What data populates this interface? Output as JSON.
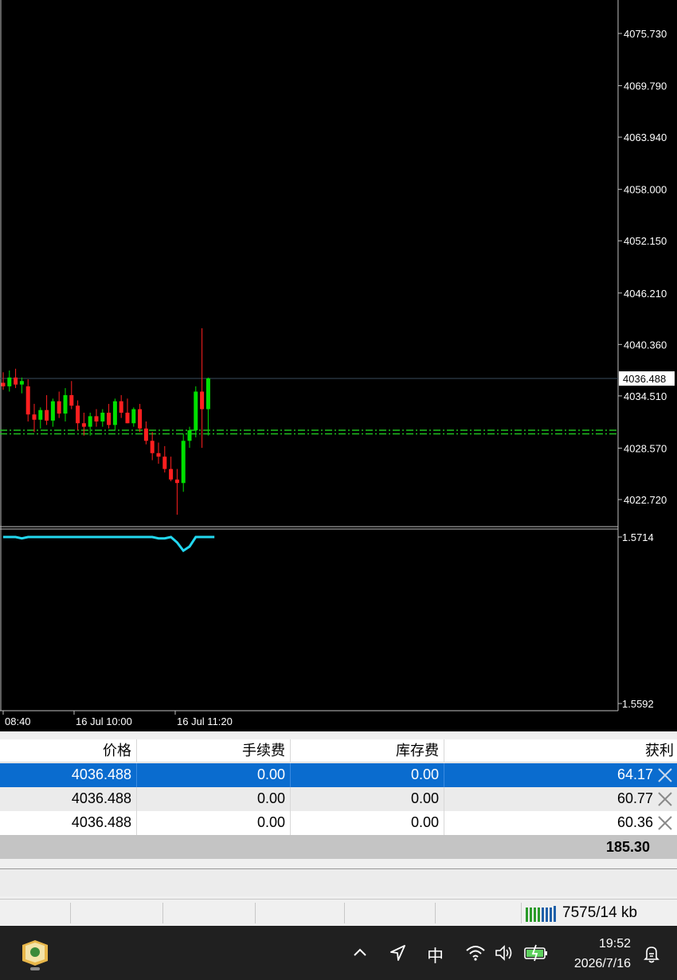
{
  "chart_data": {
    "type": "candlestick",
    "price_ticks": [
      "4075.730",
      "4069.790",
      "4063.940",
      "4058.000",
      "4052.150",
      "4046.210",
      "4040.360",
      "4034.510",
      "4028.570",
      "4022.720"
    ],
    "current_price": "4036.488",
    "indicator_ticks": [
      "1.5714",
      "1.5592"
    ],
    "time_labels": [
      "08:40",
      "16 Jul 10:00",
      "16 Jul 11:20"
    ],
    "candles": [
      {
        "o": 4036.0,
        "h": 4037.2,
        "l": 4035.2,
        "c": 4035.6
      },
      {
        "o": 4035.6,
        "h": 4037.4,
        "l": 4035.0,
        "c": 4036.6
      },
      {
        "o": 4036.6,
        "h": 4037.6,
        "l": 4035.4,
        "c": 4035.8
      },
      {
        "o": 4035.8,
        "h": 4036.6,
        "l": 4034.8,
        "c": 4036.2
      },
      {
        "o": 4035.6,
        "h": 4036.4,
        "l": 4031.6,
        "c": 4032.4
      },
      {
        "o": 4032.4,
        "h": 4033.6,
        "l": 4030.4,
        "c": 4031.8
      },
      {
        "o": 4031.8,
        "h": 4033.2,
        "l": 4030.8,
        "c": 4032.9
      },
      {
        "o": 4032.9,
        "h": 4034.6,
        "l": 4031.2,
        "c": 4031.7
      },
      {
        "o": 4031.7,
        "h": 4034.2,
        "l": 4031.0,
        "c": 4033.9
      },
      {
        "o": 4033.9,
        "h": 4035.0,
        "l": 4032.0,
        "c": 4032.5
      },
      {
        "o": 4032.5,
        "h": 4035.4,
        "l": 4031.6,
        "c": 4034.6
      },
      {
        "o": 4034.6,
        "h": 4036.2,
        "l": 4033.0,
        "c": 4033.4
      },
      {
        "o": 4033.4,
        "h": 4034.0,
        "l": 4030.6,
        "c": 4031.4
      },
      {
        "o": 4031.4,
        "h": 4032.6,
        "l": 4030.0,
        "c": 4031.0
      },
      {
        "o": 4031.0,
        "h": 4032.6,
        "l": 4030.0,
        "c": 4032.2
      },
      {
        "o": 4032.2,
        "h": 4033.0,
        "l": 4031.0,
        "c": 4031.6
      },
      {
        "o": 4031.6,
        "h": 4033.0,
        "l": 4031.0,
        "c": 4032.6
      },
      {
        "o": 4032.6,
        "h": 4033.6,
        "l": 4030.8,
        "c": 4031.2
      },
      {
        "o": 4031.2,
        "h": 4034.2,
        "l": 4030.6,
        "c": 4033.9
      },
      {
        "o": 4033.9,
        "h": 4034.6,
        "l": 4032.0,
        "c": 4032.6
      },
      {
        "o": 4032.6,
        "h": 4034.2,
        "l": 4031.4,
        "c": 4031.4
      },
      {
        "o": 4031.4,
        "h": 4033.2,
        "l": 4031.0,
        "c": 4033.0
      },
      {
        "o": 4033.0,
        "h": 4033.6,
        "l": 4030.4,
        "c": 4030.8
      },
      {
        "o": 4030.8,
        "h": 4031.6,
        "l": 4029.0,
        "c": 4029.4
      },
      {
        "o": 4029.4,
        "h": 4030.4,
        "l": 4027.2,
        "c": 4028.0
      },
      {
        "o": 4028.0,
        "h": 4029.2,
        "l": 4026.8,
        "c": 4027.6
      },
      {
        "o": 4027.6,
        "h": 4028.8,
        "l": 4025.8,
        "c": 4026.2
      },
      {
        "o": 4026.2,
        "h": 4027.6,
        "l": 4024.8,
        "c": 4025.0
      },
      {
        "o": 4025.0,
        "h": 4026.2,
        "l": 4021.0,
        "c": 4024.6
      },
      {
        "o": 4024.6,
        "h": 4030.2,
        "l": 4023.6,
        "c": 4029.4
      },
      {
        "o": 4029.4,
        "h": 4031.0,
        "l": 4028.6,
        "c": 4030.6
      },
      {
        "o": 4030.6,
        "h": 4035.6,
        "l": 4029.8,
        "c": 4035.0
      },
      {
        "o": 4035.0,
        "h": 4042.2,
        "l": 4028.6,
        "c": 4033.0
      },
      {
        "o": 4033.0,
        "h": 4036.6,
        "l": 4030.0,
        "c": 4036.5
      }
    ],
    "levels": [
      4030.6,
      4030.2
    ],
    "indicator_series": [
      1.5714,
      1.5714,
      1.5714,
      1.5713,
      1.5714,
      1.5714,
      1.5714,
      1.5714,
      1.5714,
      1.5714,
      1.5714,
      1.5714,
      1.5714,
      1.5714,
      1.5714,
      1.5714,
      1.5714,
      1.5714,
      1.5714,
      1.5714,
      1.5714,
      1.5714,
      1.5714,
      1.5714,
      1.5714,
      1.5713,
      1.5713,
      1.5714,
      1.571,
      1.5704,
      1.5707,
      1.5714,
      1.5714,
      1.5714,
      1.5714
    ],
    "colors": {
      "up": "#00e000",
      "down": "#ff1f1f",
      "indicator": "#22d8f0",
      "level": "#1fbf1f",
      "current_line": "#3a4b5e"
    }
  },
  "table": {
    "headers": [
      "价格",
      "手续费",
      "库存费",
      "获利"
    ],
    "rows": [
      {
        "price": "4036.488",
        "commission": "0.00",
        "swap": "0.00",
        "profit": "64.17"
      },
      {
        "price": "4036.488",
        "commission": "0.00",
        "swap": "0.00",
        "profit": "60.77"
      },
      {
        "price": "4036.488",
        "commission": "0.00",
        "swap": "0.00",
        "profit": "60.36"
      }
    ],
    "total": "185.30"
  },
  "status_bar": {
    "connection": "7575/14 kb"
  },
  "taskbar": {
    "input_method": "中",
    "time": "19:52",
    "date": "2026/7/16"
  }
}
